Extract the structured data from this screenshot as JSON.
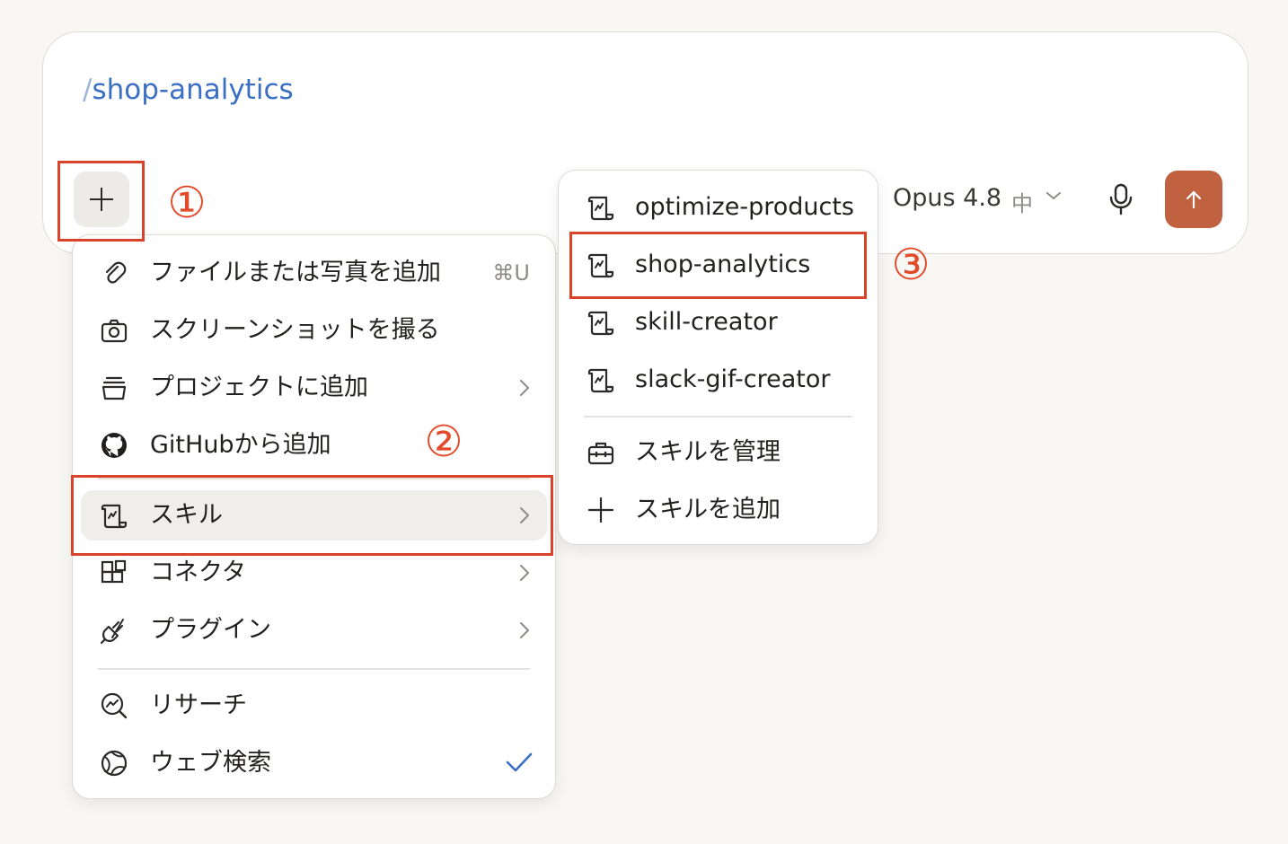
{
  "composer": {
    "command_slash": "/",
    "command_name": "shop-analytics",
    "model": "Opus 4.8",
    "effort": "中",
    "icons": {
      "add": "plus-icon",
      "mic": "microphone-icon",
      "send": "arrow-up-icon"
    },
    "send_color": "#c0613f"
  },
  "annotations": {
    "marker_1": "①",
    "marker_2": "②",
    "marker_3": "③",
    "highlight_color": "#d9432a"
  },
  "main_menu": {
    "items": [
      {
        "label": "ファイルまたは写真を追加",
        "icon": "paperclip-icon",
        "shortcut": "⌘U"
      },
      {
        "label": "スクリーンショットを撮る",
        "icon": "camera-icon"
      },
      {
        "label": "プロジェクトに追加",
        "icon": "stack-icon",
        "has_submenu": true
      },
      {
        "label": "GitHubから追加",
        "icon": "github-icon"
      },
      {
        "label": "スキル",
        "icon": "scroll-icon",
        "has_submenu": true,
        "active": true
      },
      {
        "label": "コネクタ",
        "icon": "blocks-icon",
        "has_submenu": true
      },
      {
        "label": "プラグイン",
        "icon": "plug-icon",
        "has_submenu": true
      },
      {
        "label": "リサーチ",
        "icon": "research-icon"
      },
      {
        "label": "ウェブ検索",
        "icon": "globe-icon",
        "checked": true
      }
    ]
  },
  "skills_menu": {
    "skills": [
      {
        "label": "optimize-products",
        "icon": "scroll-icon"
      },
      {
        "label": "shop-analytics",
        "icon": "scroll-icon"
      },
      {
        "label": "skill-creator",
        "icon": "scroll-icon"
      },
      {
        "label": "slack-gif-creator",
        "icon": "scroll-icon"
      }
    ],
    "actions": [
      {
        "label": "スキルを管理",
        "icon": "toolbox-icon"
      },
      {
        "label": "スキルを追加",
        "icon": "plus-icon"
      }
    ]
  }
}
